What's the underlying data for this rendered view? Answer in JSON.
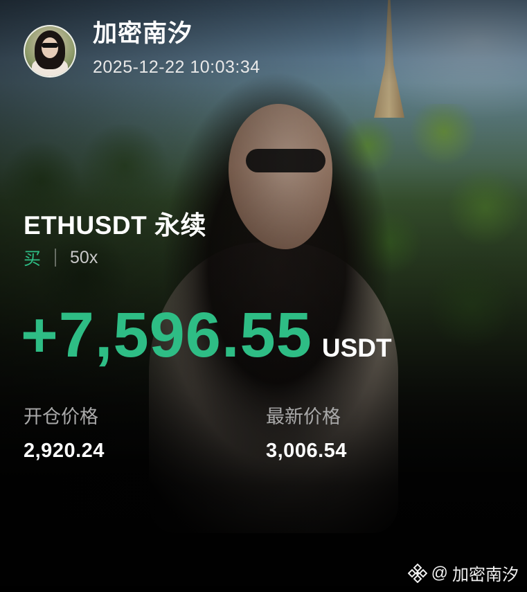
{
  "header": {
    "username": "加密南汐",
    "timestamp": "2025-12-22 10:03:34"
  },
  "position": {
    "pair": "ETHUSDT 永续",
    "side": "买",
    "leverage": "50x",
    "pnl": "+7,596.55",
    "pnl_unit": "USDT"
  },
  "stats": {
    "entry_label": "开仓价格",
    "entry_value": "2,920.24",
    "last_label": "最新价格",
    "last_value": "3,006.54"
  },
  "watermark": {
    "icon": "binance-diamond-icon",
    "at": "@",
    "name": "加密南汐"
  },
  "colors": {
    "positive": "#2ebd85",
    "text_primary": "#ffffff",
    "text_secondary": "#a9a9a9"
  }
}
